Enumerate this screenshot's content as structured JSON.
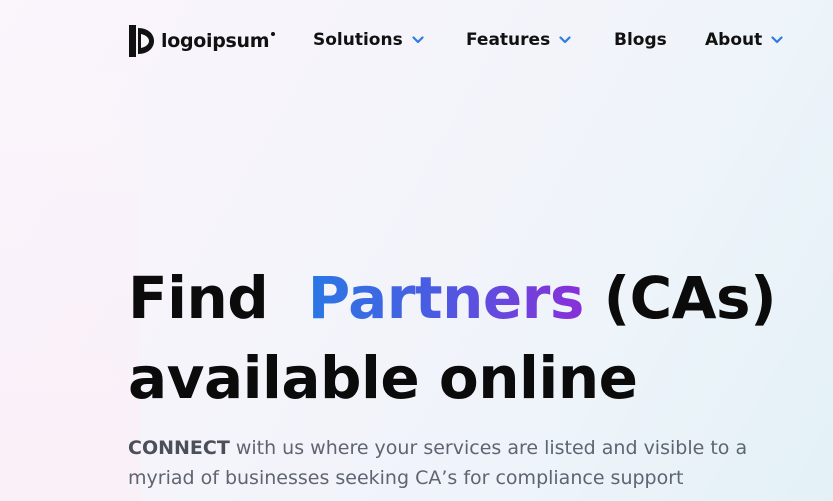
{
  "brand": {
    "name": "logoipsum"
  },
  "nav": {
    "items": [
      {
        "label": "Solutions",
        "has_dropdown": true
      },
      {
        "label": "Features",
        "has_dropdown": true
      },
      {
        "label": "Blogs",
        "has_dropdown": false
      },
      {
        "label": "About",
        "has_dropdown": true
      }
    ],
    "chevron_color": "#2f7be6"
  },
  "hero": {
    "title_part1": "Find",
    "title_highlight": "Partners",
    "title_part2": "(CAs)",
    "title_line2": "available online",
    "subtitle_bold": "CONNECT",
    "subtitle_rest": " with us where your services are listed and visible to a myriad of businesses seeking CA’s for compliance support"
  },
  "colors": {
    "gradient_start": "#2a78e4",
    "gradient_end": "#8a2fd8",
    "text_dark": "#0b0b0b",
    "text_muted": "#5f6470"
  }
}
